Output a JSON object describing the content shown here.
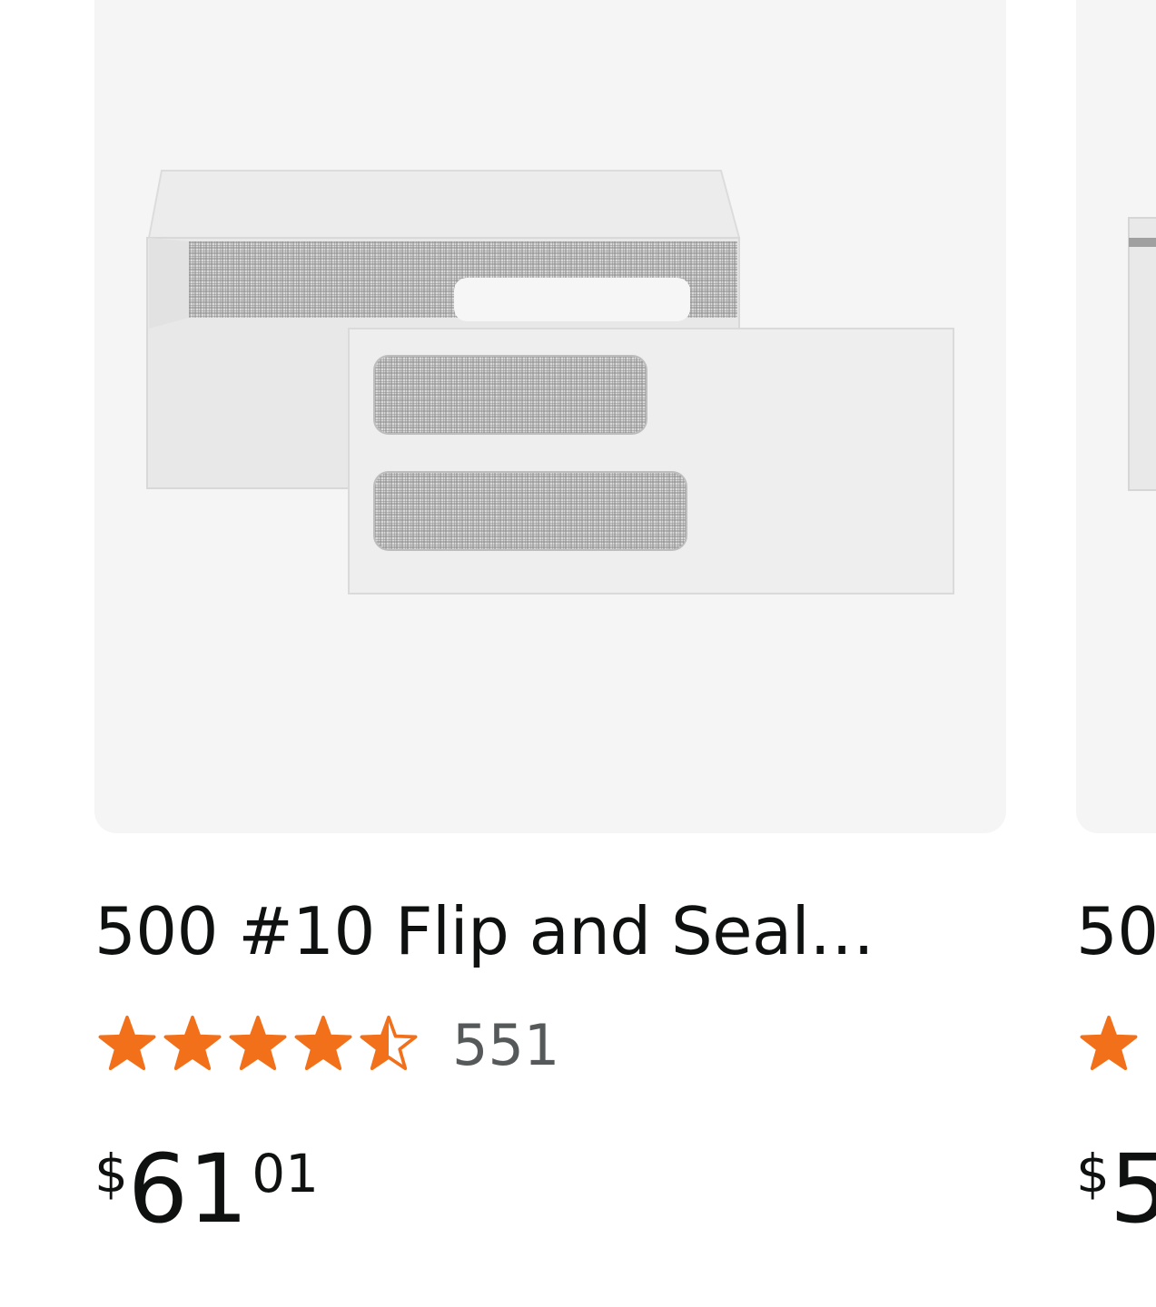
{
  "products": [
    {
      "title": "500 #10 Flip and Seal…",
      "rating": 4.5,
      "rating_max": 5,
      "review_count": "551",
      "price": {
        "symbol": "$",
        "whole": "61",
        "fraction": "01"
      },
      "image_icon": "double-window-envelope-image"
    },
    {
      "title": "50",
      "price": {
        "symbol": "$",
        "whole": "5",
        "fraction": ""
      },
      "image_icon": "envelope-image"
    }
  ],
  "colors": {
    "star": "#f3701a",
    "image_bg": "#f5f5f5",
    "title": "#0f1111",
    "review_count": "#565959"
  }
}
